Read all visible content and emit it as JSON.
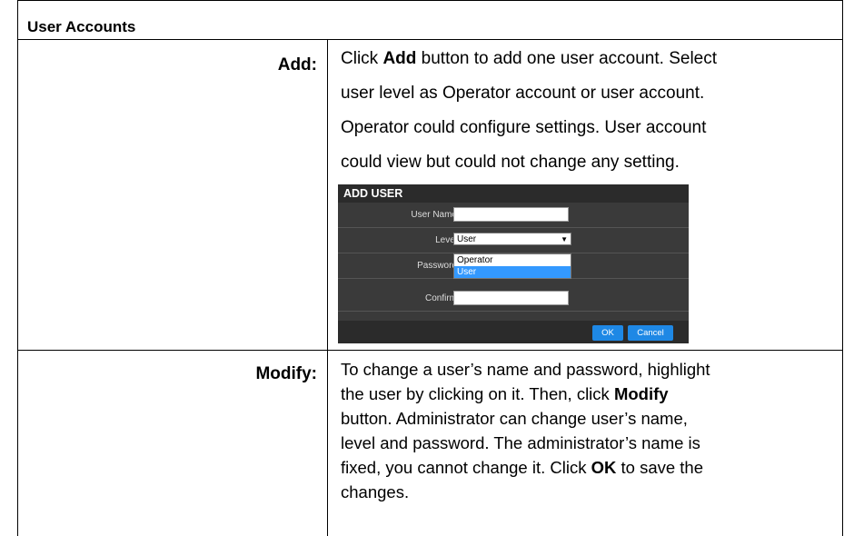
{
  "header": {
    "title": "User Accounts"
  },
  "add": {
    "label": "Add:",
    "line1_a": "Click ",
    "line1_b": "Add",
    "line1_c": " button to add one user account. Select",
    "line2": "user level as Operator account or user account.",
    "line3": "Operator could configure settings.  User account",
    "line4": "could view but could not change any setting."
  },
  "dialog": {
    "title": "ADD USER",
    "username_label": "User Name",
    "level_label": "Level",
    "level_value": "User",
    "level_options": [
      "Operator",
      "User"
    ],
    "password_label": "Password",
    "confirm_label": "Confirm",
    "ok_label": "OK",
    "cancel_label": "Cancel"
  },
  "modify": {
    "label": "Modify:",
    "line1": "To change a user’s name and password, highlight",
    "line2_a": "the user by clicking on it. Then, click ",
    "line2_b": "Modify",
    "line3": "button. Administrator can change user’s name,",
    "line4": "level and password. The administrator’s name is",
    "line5_a": "fixed, you cannot change it.  Click ",
    "line5_b": "OK",
    "line5_c": " to save the",
    "line6": "changes."
  }
}
